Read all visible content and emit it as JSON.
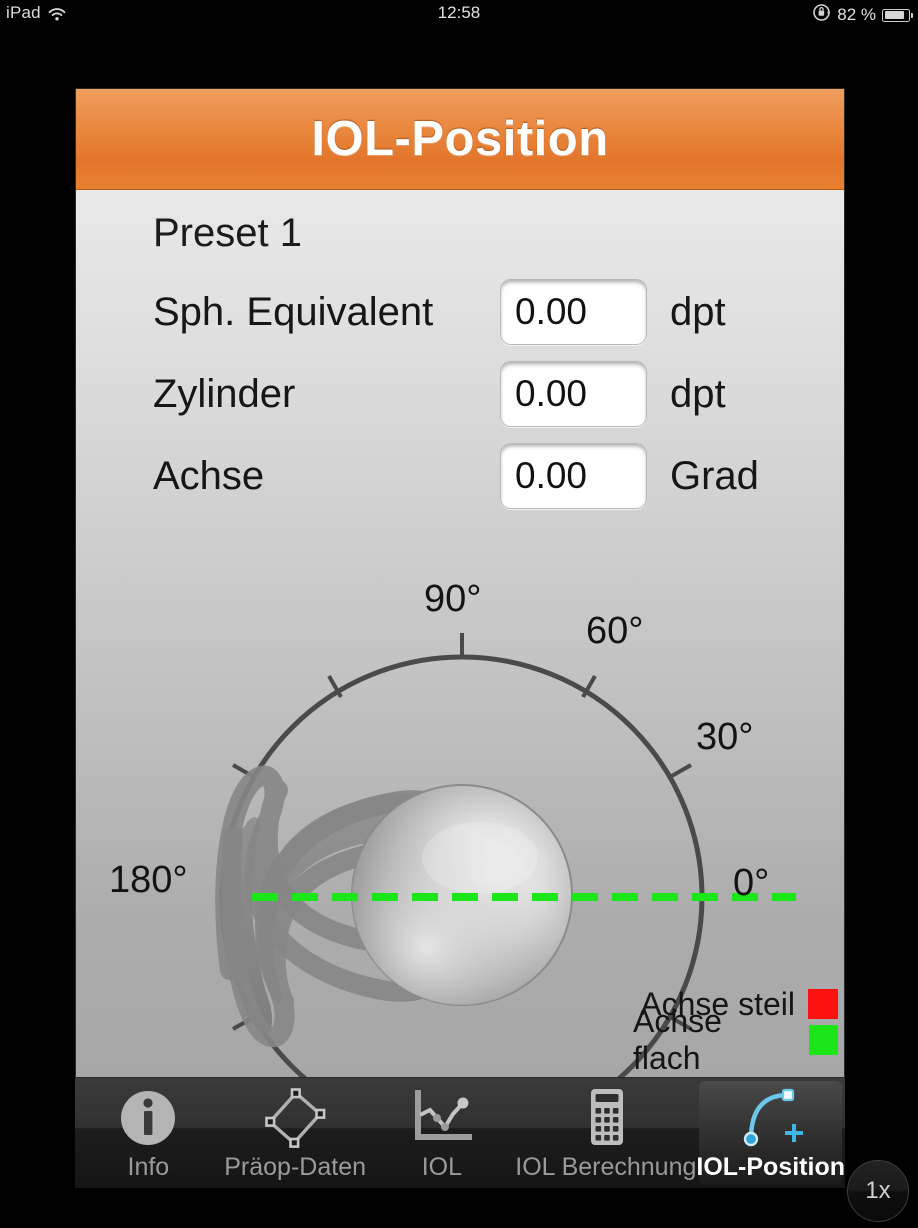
{
  "status_bar": {
    "device": "iPad",
    "wifi_icon": "wifi-icon",
    "time": "12:58",
    "rotation_lock_icon": "rotation-lock-icon",
    "battery_percent": "82 %",
    "battery_icon": "battery-icon"
  },
  "window": {
    "title": "IOL-Position"
  },
  "form": {
    "preset_label": "Preset 1",
    "rows": [
      {
        "label": "Sph. Equivalent",
        "value": "0.00",
        "unit": "dpt"
      },
      {
        "label": "Zylinder",
        "value": "0.00",
        "unit": "dpt"
      },
      {
        "label": "Achse",
        "value": "0.00",
        "unit": "Grad"
      }
    ]
  },
  "diagram": {
    "axis_labels": [
      "90°",
      "60°",
      "30°",
      "0°",
      "180°"
    ],
    "tick_degrees": [
      0,
      30,
      60,
      90,
      120,
      150,
      180,
      210,
      240,
      270,
      300,
      330
    ],
    "axis_line_degrees": 0,
    "axis_line_color": "#1ae619",
    "circle_stroke": "#4a4a4a",
    "legend": [
      {
        "label": "Achse steil",
        "color": "#fe1111"
      },
      {
        "label": "Achse flach",
        "color": "#1ae619"
      }
    ]
  },
  "tabbar": {
    "items": [
      {
        "label": "Info",
        "icon": "info-circle-icon",
        "active": false
      },
      {
        "label": "Präop-Daten",
        "icon": "diamond-nodes-icon",
        "active": false
      },
      {
        "label": "IOL",
        "icon": "line-chart-icon",
        "active": false
      },
      {
        "label": "IOL Berechnung",
        "icon": "calculator-icon",
        "active": false
      },
      {
        "label": "IOL-Position",
        "icon": "bezier-curve-icon",
        "active": true
      }
    ]
  },
  "scale_button": {
    "label": "1x"
  }
}
